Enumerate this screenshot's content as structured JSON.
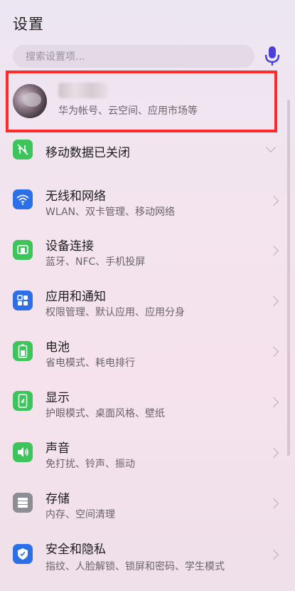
{
  "header": {
    "title": "设置"
  },
  "search": {
    "placeholder": "搜索设置项..."
  },
  "account": {
    "subtitle": "华为帐号、云空间、应用市场等"
  },
  "mobile_data": {
    "label": "移动数据已关闭"
  },
  "items": [
    {
      "title": "无线和网络",
      "subtitle": "WLAN、双卡管理、移动网络",
      "icon": "wifi-icon"
    },
    {
      "title": "设备连接",
      "subtitle": "蓝牙、NFC、手机投屏",
      "icon": "device-connection-icon"
    },
    {
      "title": "应用和通知",
      "subtitle": "权限管理、默认应用、应用分身",
      "icon": "apps-grid-icon"
    },
    {
      "title": "电池",
      "subtitle": "省电模式、耗电排行",
      "icon": "battery-icon"
    },
    {
      "title": "显示",
      "subtitle": "护眼模式、桌面风格、壁纸",
      "icon": "display-icon"
    },
    {
      "title": "声音",
      "subtitle": "免打扰、铃声、振动",
      "icon": "speaker-icon"
    },
    {
      "title": "存储",
      "subtitle": "内存、空间清理",
      "icon": "storage-icon"
    },
    {
      "title": "安全和隐私",
      "subtitle": "指纹、人脸解锁、锁屏和密码、学生模式",
      "icon": "shield-icon"
    }
  ],
  "colors": {
    "highlight_border": "#ff2b2b",
    "icon_green": "#3dc45b",
    "icon_blue": "#2c6fe6",
    "icon_gray": "#8d8d95",
    "mic_blue": "#4a3fd8"
  }
}
